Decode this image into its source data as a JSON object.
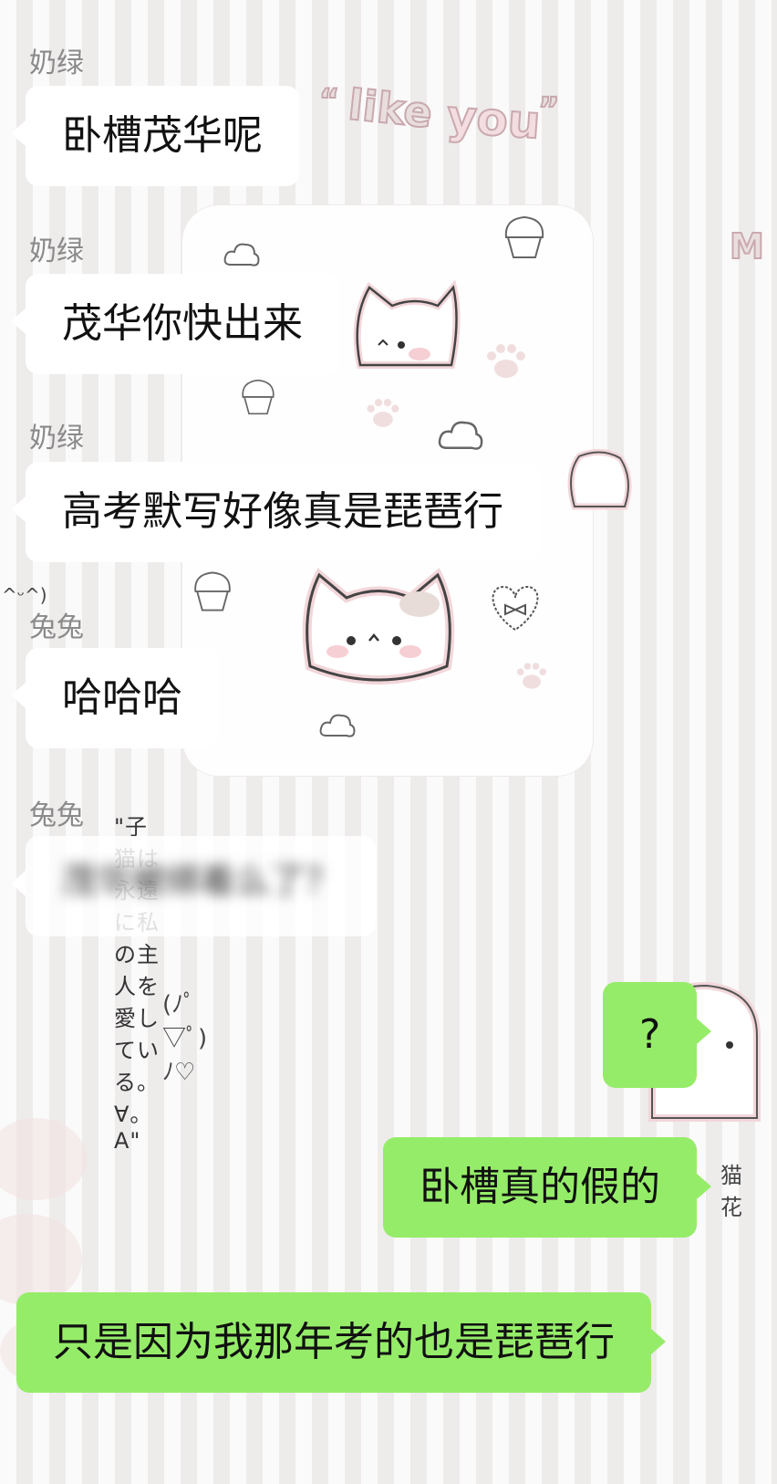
{
  "messages": [
    {
      "sender": "奶绿",
      "text": "卧槽茂华呢"
    },
    {
      "sender": "奶绿",
      "text": "茂华你快出来"
    },
    {
      "sender": "奶绿",
      "text": "高考默写好像真是琵琶行"
    },
    {
      "sender": "兔兔",
      "text": "哈哈哈"
    },
    {
      "sender": "兔兔",
      "text": "茂华被绑着么了？"
    },
    {
      "text": "?"
    },
    {
      "text": "卧槽真的假的"
    },
    {
      "text": "只是因为我那年考的也是琵琶行"
    }
  ],
  "wallpaper": {
    "text_like": "like",
    "text_you": "you",
    "jp_line": "\"子猫は永遠に私の主人を愛している。∀。A\"",
    "kaomoji": "(ﾉﾟ▽ﾟ)ﾉ♡",
    "left_kaomoji": "^ᵕ^)",
    "right_fragment_m": "M",
    "right_fragment_cat": "猫花"
  },
  "colors": {
    "outgoing_bubble": "#95ec69",
    "incoming_bubble": "#ffffff",
    "sender_name": "#8a8a8a"
  }
}
